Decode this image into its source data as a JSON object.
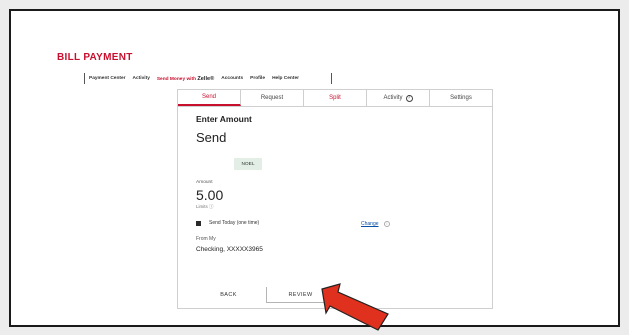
{
  "page": {
    "title": "BILL PAYMENT",
    "nav": [
      {
        "label": "Payment Center",
        "active": false
      },
      {
        "label": "Activity",
        "active": false
      },
      {
        "label": "Send Money with",
        "active": true
      },
      {
        "label": "Accounts",
        "active": false
      },
      {
        "label": "Profile",
        "active": false
      },
      {
        "label": "Help Center",
        "active": false
      }
    ],
    "zelle_mark": "Zelle®"
  },
  "tabs": [
    "Send",
    "Request",
    "Split",
    "Activity",
    "Settings"
  ],
  "tab_help_glyph": "?",
  "form": {
    "heading": "Enter Amount",
    "subheading": "Send",
    "recipient": "NOEL",
    "amount_label": "Amount",
    "amount": "5.00",
    "limit_text": "Limits ⓘ",
    "send_option": "Send Today (one time)",
    "change_link": "Change",
    "info_glyph": "i",
    "from_label": "From My",
    "from_account": "Checking, XXXXX3965"
  },
  "buttons": {
    "back": "BACK",
    "review": "REVIEW"
  },
  "colors": {
    "accent": "#c8102e",
    "arrow": "#e0301e",
    "link": "#0a4fa3"
  }
}
